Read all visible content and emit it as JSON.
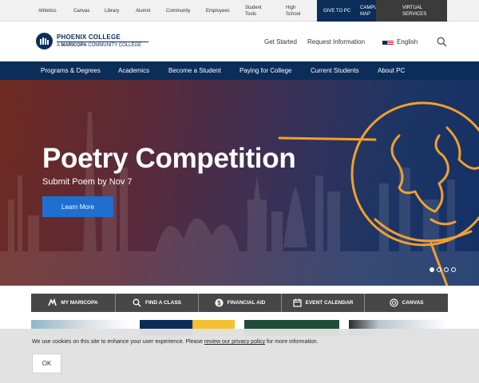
{
  "utility_nav": {
    "items": [
      "Athletics",
      "Canvas",
      "Library",
      "Alumni",
      "Community",
      "Employees",
      "Student Tools",
      "High School"
    ],
    "give": "GIVE TO PC",
    "map": "CAMPUS MAP",
    "virtual": "VIRTUAL SERVICES"
  },
  "header": {
    "logo_title": "PHOENIX COLLEGE",
    "logo_prefix": "A ",
    "logo_sub_bold": "MARICOPA",
    "logo_sub_rest": " COMMUNITY COLLEGE",
    "get_started": "Get Started",
    "request_info": "Request Information",
    "language": "English"
  },
  "main_nav": [
    "Programs & Degrees",
    "Academics",
    "Become a Student",
    "Paying for College",
    "Current Students",
    "About PC"
  ],
  "hero": {
    "title": "Poetry Competition",
    "subtitle": "Submit Poem by Nov 7",
    "button": "Learn More",
    "slides_total": 4,
    "slide_active": 1
  },
  "quick_links": [
    {
      "label": "MY MARICOPA",
      "icon": "maricopa-icon"
    },
    {
      "label": "FIND A CLASS",
      "icon": "search-icon"
    },
    {
      "label": "FINANCIAL AID",
      "icon": "dollar-icon"
    },
    {
      "label": "EVENT CALENDAR",
      "icon": "calendar-icon"
    },
    {
      "label": "CANVAS",
      "icon": "canvas-icon"
    }
  ],
  "cookie": {
    "text_before": "We use cookies on this site to enhance your user experience. Please ",
    "link": "review our privacy policy",
    "text_after": " for more information.",
    "ok": "OK"
  },
  "colors": {
    "navy": "#0b2d5a",
    "button_blue": "#1f6fd1",
    "globe_orange": "#f0a030",
    "quick_bar": "#474747"
  }
}
